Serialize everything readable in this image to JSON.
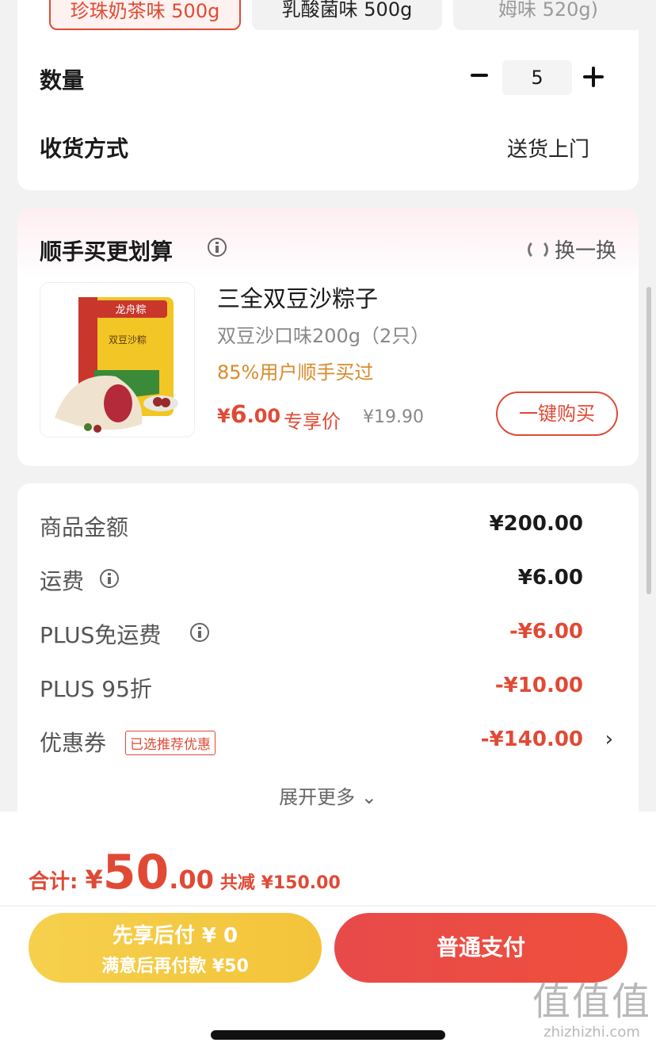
{
  "variants": [
    {
      "label": "珍珠奶茶味 500g",
      "selected": true
    },
    {
      "label": "乳酸菌味 500g",
      "selected": false
    },
    {
      "label": "姆味 520g)",
      "selected": false
    }
  ],
  "order_options": {
    "quantity_label": "数量",
    "quantity_value": "5",
    "delivery_label": "收货方式",
    "delivery_value": "送货上门"
  },
  "upsell": {
    "title": "顺手买更划算",
    "refresh_label": "换一换",
    "product": {
      "name": "三全双豆沙粽子",
      "spec": "双豆沙口味200g（2只）",
      "social_proof": "85%用户顺手买过",
      "price_currency": "¥",
      "price_int": "6",
      "price_dec": ".00",
      "price_label": "专享价",
      "original_price": "¥19.90",
      "buy_button": "一键购买",
      "package_brand": "龙舟粽",
      "package_name": "双豆沙粽"
    }
  },
  "fees": {
    "rows": [
      {
        "label": "商品金额",
        "value": "¥200.00"
      },
      {
        "label": "运费",
        "value": "¥6.00"
      },
      {
        "label": "PLUS免运费",
        "value": "-¥6.00"
      },
      {
        "label": "PLUS 95折",
        "value": "-¥10.00"
      },
      {
        "label": "优惠券",
        "value": "-¥140.00",
        "tag": "已选推荐优惠"
      }
    ],
    "expand_label": "展开更多 ⌄"
  },
  "footer": {
    "total_label": "合计: ",
    "total_currency": "¥",
    "total_int": "50",
    "total_dec": ".00",
    "total_saving": "共减 ¥150.00",
    "pay_later_line1": "先享后付 ¥ 0",
    "pay_later_line2": "满意后再付款 ¥50",
    "pay_button": "普通支付"
  },
  "watermark": {
    "big": "值值值",
    "small": "zhizhizhi.com"
  },
  "colors": {
    "accent": "#e04a35",
    "gold": "#f5c842",
    "social": "#d98a2b"
  }
}
